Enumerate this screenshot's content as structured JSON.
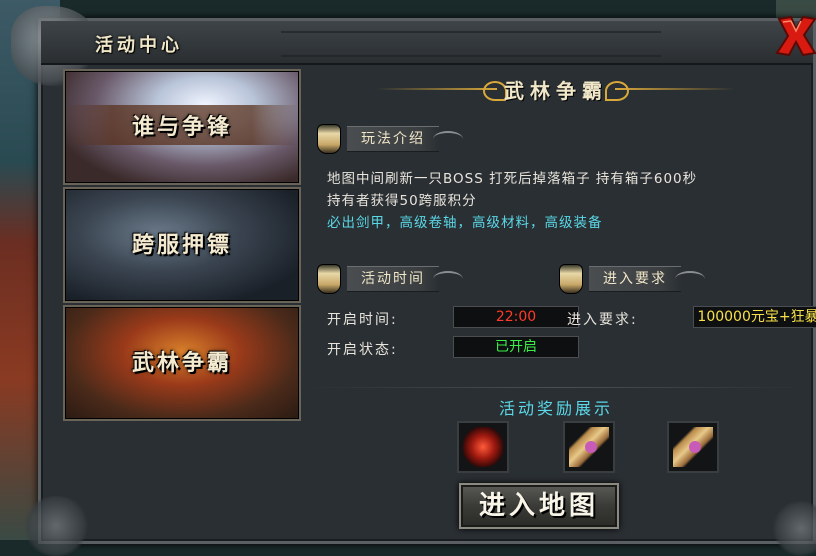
{
  "window": {
    "title": "活动中心",
    "close_icon": "close-x-icon"
  },
  "sidebar": {
    "items": [
      {
        "label": "谁与争锋"
      },
      {
        "label": "跨服押镖"
      },
      {
        "label": "武林争霸"
      }
    ]
  },
  "main": {
    "heading": "武林争霸",
    "gameplay": {
      "title": "玩法介绍",
      "lines": [
        "地图中间刷新一只BOSS  打死后掉落箱子  持有箱子600秒",
        "持有者获得50跨服积分"
      ],
      "highlight": "必出剑甲，高级卷轴，高级材料，高级装备"
    },
    "schedule": {
      "title": "活动时间",
      "open_time_label": "开启时间:",
      "open_time_value": "22:00",
      "status_label": "开启状态:",
      "status_value": "已开启"
    },
    "requirement": {
      "title": "进入要求",
      "label": "进入要求:",
      "value": "100000元宝+狂暴"
    },
    "rewards": {
      "title": "活动奖励展示",
      "items": [
        "red-gem-icon",
        "scroll-icon",
        "scroll-icon"
      ]
    },
    "enter_button": "进入地图"
  },
  "colors": {
    "time": "#ff3a2a",
    "status": "#3aef4a",
    "requirement": "#f8e048",
    "highlight": "#5ad8e8"
  }
}
